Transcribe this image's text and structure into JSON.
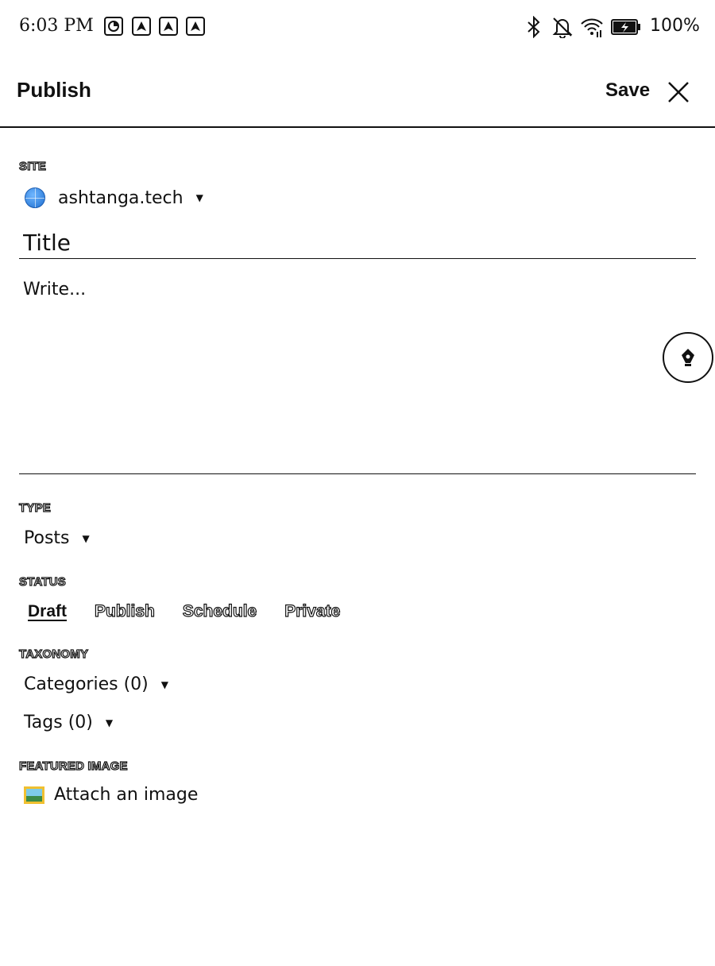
{
  "status_bar": {
    "time": "6:03 PM",
    "notification_icons": [
      "pie-chart-icon",
      "app-a-icon",
      "app-a-icon",
      "app-a-icon"
    ],
    "system_icons": [
      "bluetooth-icon",
      "bell-off-icon",
      "wifi-icon",
      "battery-charging-icon"
    ],
    "battery": "100%"
  },
  "app_bar": {
    "title": "Publish",
    "save_label": "Save"
  },
  "site": {
    "label": "SITE",
    "selected": "ashtanga.tech"
  },
  "editor": {
    "title_placeholder": "Title",
    "body_placeholder": "Write..."
  },
  "type": {
    "label": "TYPE",
    "selected": "Posts"
  },
  "status": {
    "label": "STATUS",
    "options": [
      "Draft",
      "Publish",
      "Schedule",
      "Private"
    ],
    "selected": "Draft"
  },
  "taxonomy": {
    "label": "TAXONOMY",
    "categories": "Categories (0)",
    "tags": "Tags (0)"
  },
  "featured_image": {
    "label": "FEATURED IMAGE",
    "attach_label": "Attach an image"
  }
}
